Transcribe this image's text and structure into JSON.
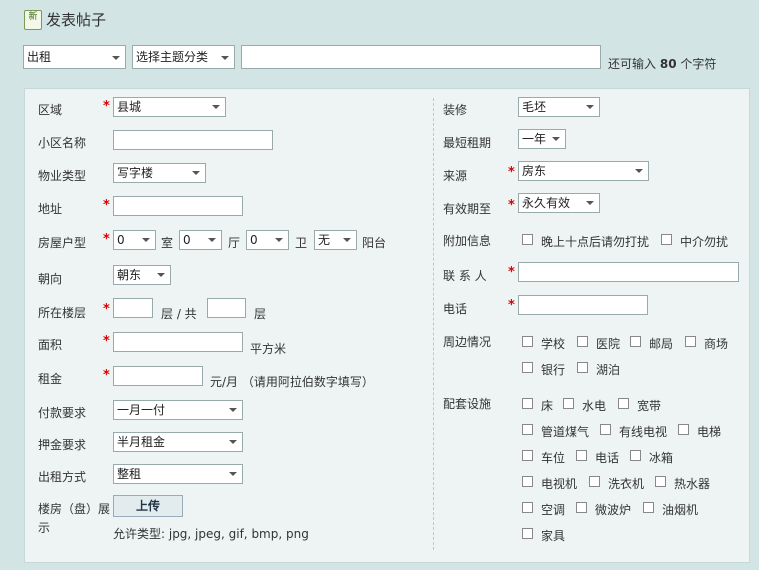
{
  "header": {
    "title": "发表帖子",
    "icon_text": "新"
  },
  "top_bar": {
    "type_select": "出租",
    "category_select": "选择主题分类",
    "subject_value": "",
    "remaining_prefix": "还可输入",
    "remaining_count": "80",
    "remaining_suffix": "个字符"
  },
  "left": {
    "district": {
      "label": "区域",
      "value": "县城"
    },
    "community": {
      "label": "小区名称",
      "value": ""
    },
    "property_type": {
      "label": "物业类型",
      "value": "写字楼"
    },
    "address": {
      "label": "地址",
      "value": ""
    },
    "layout": {
      "label": "房屋户型",
      "rooms": "0",
      "rooms_unit": "室",
      "halls": "0",
      "halls_unit": "厅",
      "baths": "0",
      "baths_unit": "卫",
      "balcony": "无",
      "balcony_unit": "阳台"
    },
    "orientation": {
      "label": "朝向",
      "value": "朝东"
    },
    "floor": {
      "label": "所在楼层",
      "floor_unit": "层 / 共",
      "total_unit": "层"
    },
    "area": {
      "label": "面积",
      "unit": "平方米"
    },
    "rent": {
      "label": "租金",
      "unit": "元/月 （请用阿拉伯数字填写）"
    },
    "payment": {
      "label": "付款要求",
      "value": "一月一付"
    },
    "deposit": {
      "label": "押金要求",
      "value": "半月租金"
    },
    "rent_mode": {
      "label": "出租方式",
      "value": "整租"
    },
    "gallery": {
      "label_line1": "楼房（盘）展",
      "label_line2": "示",
      "upload_label": "上传",
      "allowed_types": "允许类型: jpg, jpeg, gif, bmp, png"
    }
  },
  "right": {
    "decoration": {
      "label": "装修",
      "value": "毛坯"
    },
    "min_term": {
      "label": "最短租期",
      "value": "一年"
    },
    "source": {
      "label": "来源",
      "value": "房东"
    },
    "validity": {
      "label": "有效期至",
      "value": "永久有效"
    },
    "extra_info": {
      "label": "附加信息",
      "options": [
        "晚上十点后请勿打扰",
        "中介勿扰"
      ]
    },
    "contact": {
      "label": "联 系 人"
    },
    "phone": {
      "label": "电话"
    },
    "surroundings": {
      "label": "周边情况",
      "options": [
        "学校",
        "医院",
        "邮局",
        "商场",
        "银行",
        "湖泊"
      ]
    },
    "facilities": {
      "label": "配套设施",
      "options": [
        "床",
        "水电",
        "宽带",
        "管道煤气",
        "有线电视",
        "电梯",
        "车位",
        "电话",
        "冰箱",
        "电视机",
        "洗衣机",
        "热水器",
        "空调",
        "微波炉",
        "油烟机",
        "家具"
      ]
    }
  },
  "colors": {
    "background": "#d2e4e4",
    "panel": "#eef4f4",
    "required": "#dd0000"
  }
}
